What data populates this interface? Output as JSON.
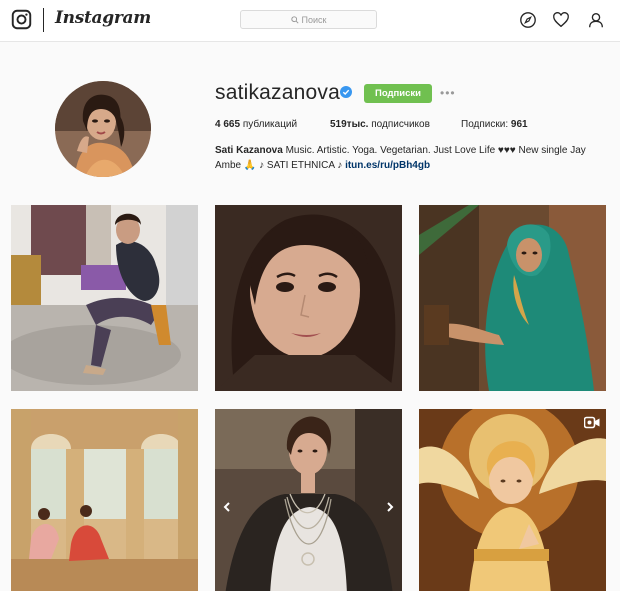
{
  "header": {
    "logo_text": "Instagram",
    "search_placeholder": "Поиск",
    "icons": [
      "instagram-camera-icon",
      "search-icon",
      "explore-compass-icon",
      "activity-heart-icon",
      "profile-person-icon"
    ]
  },
  "profile": {
    "username": "satikazanova",
    "verified": true,
    "follow_label": "Подписки",
    "more_label": "•••",
    "stats": [
      {
        "value": "4 665",
        "label": "публикаций"
      },
      {
        "value": "519тыс.",
        "label": "подписчиков"
      },
      {
        "label": "Подписки:",
        "value": "961"
      }
    ],
    "bio_name": "Sati Kazanova",
    "bio_text": " Music. Artistic. Yoga. Vegetarian. Just Love Life ♥♥♥ New single Jay Ambe 🙏 ♪ SATI ETHNICA ♪ ",
    "bio_link": "itun.es/ru/pBh4gb"
  },
  "posts": [
    {
      "subject": "woman-sitting-dressing-room-photo"
    },
    {
      "subject": "close-up-selfie-photo"
    },
    {
      "subject": "woman-teal-shawl-photo"
    },
    {
      "subject": "yoga-palace-columns-photo"
    },
    {
      "subject": "woman-necklaces-photo",
      "carousel": true
    },
    {
      "subject": "golden-angel-painting-photo",
      "video": true
    }
  ],
  "colors": {
    "follow_button": "#70c050",
    "link": "#003569",
    "verified_badge": "#3897f0",
    "header_border": "#e6e6e6",
    "page_background": "#fafafa"
  }
}
